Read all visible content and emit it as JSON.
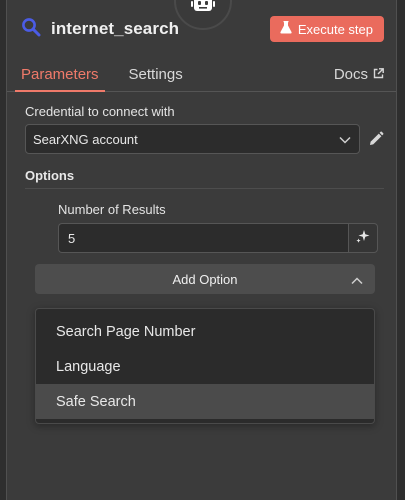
{
  "header": {
    "node_icon": "search-icon",
    "title": "internet_search",
    "execute_label": "Execute step",
    "execute_icon": "flask-icon",
    "robot_icon": "robot-icon"
  },
  "tabs": [
    {
      "label": "Parameters",
      "active": true
    },
    {
      "label": "Settings",
      "active": false
    }
  ],
  "docs": {
    "label": "Docs",
    "icon": "external-link-icon"
  },
  "credential": {
    "label": "Credential to connect with",
    "value": "SearXNG account",
    "chevron_icon": "chevron-down-icon",
    "edit_icon": "pencil-icon"
  },
  "options": {
    "heading": "Options",
    "number_of_results": {
      "label": "Number of Results",
      "value": "5",
      "icon": "sparkle-icon"
    },
    "add_option": {
      "label": "Add Option",
      "chevron_icon": "chevron-up-icon"
    },
    "dropdown_items": [
      {
        "label": "Search Page Number",
        "highlighted": false
      },
      {
        "label": "Language",
        "highlighted": false
      },
      {
        "label": "Safe Search",
        "highlighted": true
      }
    ]
  },
  "colors": {
    "accent": "#ea6b5d",
    "tab_active": "#ef7a6a",
    "search_icon": "#4b5ce6"
  }
}
